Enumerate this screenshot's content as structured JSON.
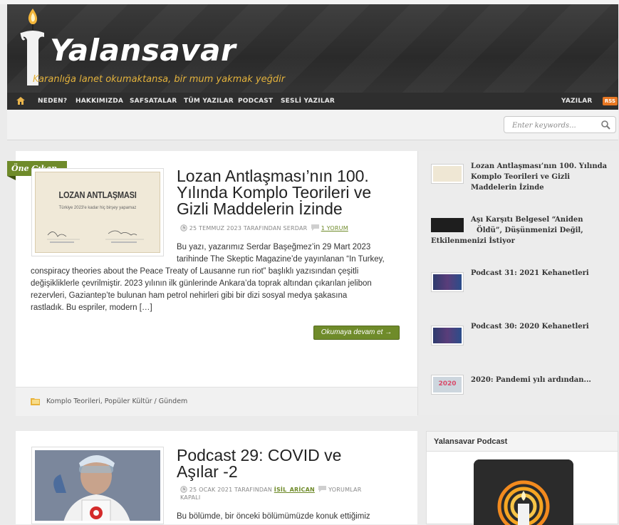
{
  "site": {
    "title": "Yalansavar",
    "tagline": "Karanlığa lanet okumaktansa, bir mum yakmak yeğdir"
  },
  "nav": {
    "items": [
      "NEDEN?",
      "HAKKIMIZDA",
      "SAFSATALAR",
      "TÜM YAZILAR",
      "PODCAST",
      "SESLİ YAZILAR"
    ],
    "right_label": "YAZILAR",
    "rss_label": "RSS"
  },
  "search": {
    "placeholder": "Enter keywords..."
  },
  "featured_post": {
    "badge": "Öne Çıkan",
    "title_lines": [
      "Lozan Antlaşması’nın 100.",
      "Yılında Komplo Teorileri ve",
      "Gizli Maddelerin İzinde"
    ],
    "date": "25 TEMMUZ 2023",
    "by": "TARAFINDAN",
    "author": "SERDAR",
    "comments": "1 YORUM",
    "excerpt_short": [
      "Bu yazı, yazarımız Serdar Başeğmez’in 29 Mart 2023",
      "tarihinde The Skeptic Magazine’de yayınlanan “In Turkey,"
    ],
    "excerpt_full": [
      "conspiracy theories about the Peace Treaty of Lausanne run riot” başlıklı yazısından çeşitli",
      "değişikliklerle çevrilmiştir. 2023 yılının ilk günlerinde Ankara’da toprak altından çıkarılan jelibon",
      "rezervleri, Gaziantep’te bulunan ham petrol nehirleri gibi bir dizi sosyal medya şakasına",
      "rastladık. Bu espriler, modern […]"
    ],
    "read_more": "Okumaya devam et →",
    "categories": "Komplo Teorileri, Popüler Kültür / Gündem",
    "thumb": {
      "heading": "LOZAN ANTLAŞMASI",
      "subtitle": "Türkiye 2023'e kadar hiç birşey yapamaz"
    }
  },
  "sidebar_list": [
    {
      "title_lines": [
        "Lozan Antlaşması’nın 100. Yılında",
        "Komplo Teorileri ve Gizli",
        "Maddelerin İzinde"
      ]
    },
    {
      "title_lines": [
        "Aşı Karşıtı Belgesel “Aniden",
        "Öldü”, Düşünmenizi Değil,",
        "Etkilenmenizi İstiyor"
      ]
    },
    {
      "title_lines": [
        "Podcast 31: 2021 Kehanetleri"
      ]
    },
    {
      "title_lines": [
        "Podcast 30: 2020 Kehanetleri"
      ]
    },
    {
      "title_lines": [
        "2020: Pandemi yılı ardından..."
      ],
      "thumb_text": "2020"
    }
  ],
  "second_post": {
    "title_lines": [
      "Podcast 29: COVID ve",
      "Aşılar -2"
    ],
    "date": "25 OCAK 2021",
    "by": "TARAFINDAN",
    "author": "İSİL_ARİCAN",
    "comments": "YORUMLAR",
    "comments_2": "KAPALI",
    "excerpt_lines": [
      "Bu bölümde, bir önceki bölümümüzde konuk ettiğimiz"
    ]
  },
  "widget": {
    "title": "Yalansavar Podcast"
  },
  "colors": {
    "accent": "#6f8b2a",
    "tagline": "#e3b23c",
    "rss": "#e87722",
    "nav": "#2e2e2e"
  }
}
